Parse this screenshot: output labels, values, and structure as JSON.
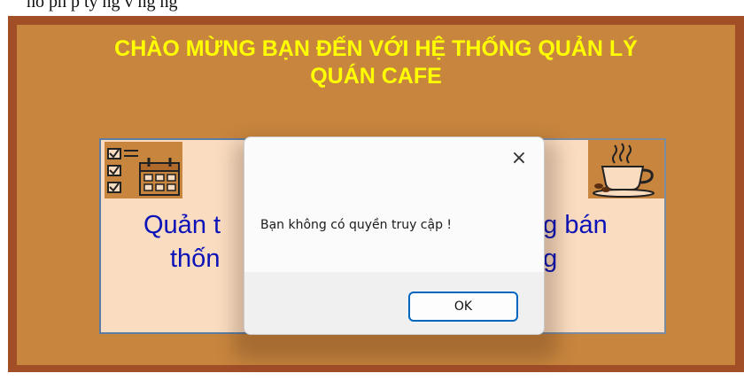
{
  "doc_fragment": "ho ph p ty ng v  ng   ng",
  "form": {
    "title_line1": "CHÀO MỪNG BẠN ĐẾN VỚI HỆ THỐNG QUẢN LÝ",
    "title_line2": "QUÁN CAFE"
  },
  "left_button": {
    "line1": "Quản t",
    "line2": "thốn",
    "icon": "checklist-calendar-icon"
  },
  "right_button": {
    "line1": "ng bán",
    "line2": "ng",
    "icon": "coffee-cup-icon"
  },
  "dialog": {
    "close_glyph": "×",
    "message": "Bạn không có quyền truy cập !",
    "ok_label": "OK"
  },
  "colors": {
    "frame": "#a24f28",
    "form_bg": "#c8853e",
    "title": "#ffff00",
    "button_bg": "#fadcc0",
    "button_text": "#0c13b8",
    "dialog_accent": "#0067c0"
  }
}
